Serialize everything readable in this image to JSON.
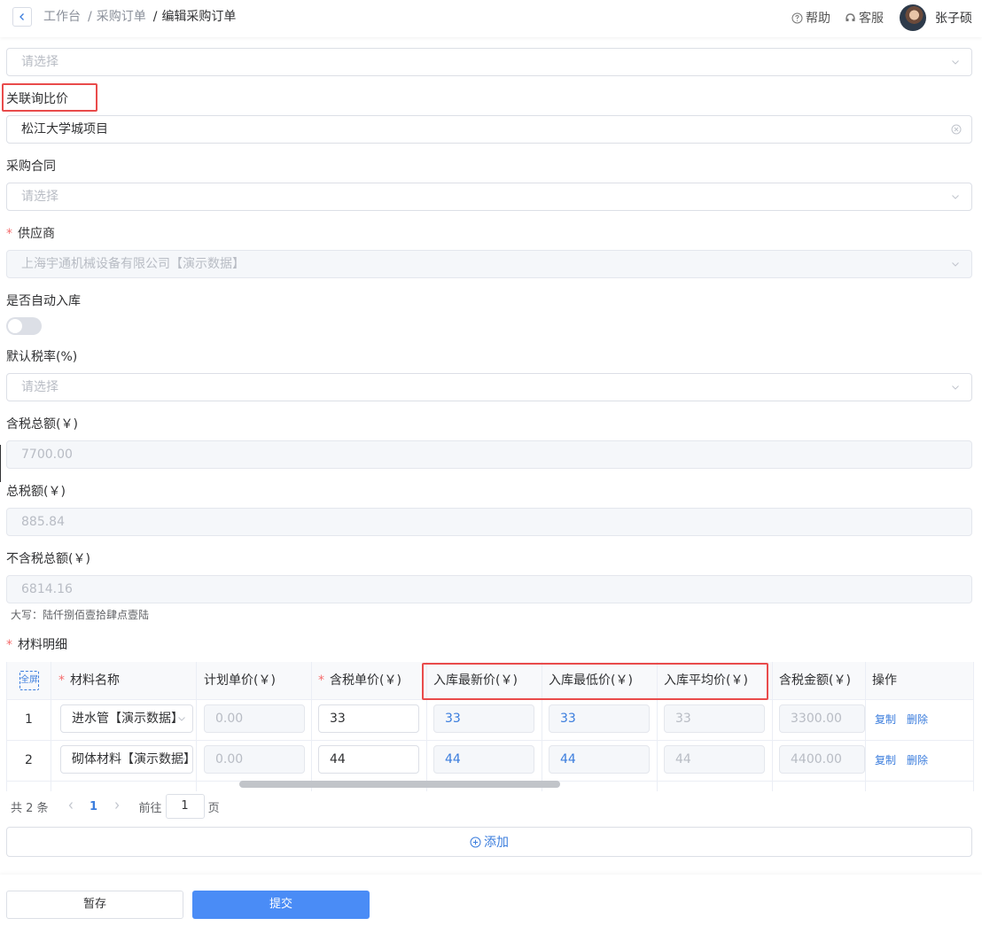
{
  "header": {
    "breadcrumb": [
      "工作台",
      "采购订单",
      "编辑采购订单"
    ],
    "help": "帮助",
    "service": "客服",
    "username": "张子硕"
  },
  "form": {
    "top_select": {
      "placeholder": "请选择"
    },
    "inquiry": {
      "label": "关联询比价",
      "value": "松江大学城项目"
    },
    "contract": {
      "label": "采购合同",
      "placeholder": "请选择"
    },
    "supplier": {
      "label": "供应商",
      "value": "上海宇通机械设备有限公司【演示数据】",
      "required": true
    },
    "auto_stock": {
      "label": "是否自动入库",
      "on": false
    },
    "tax_rate": {
      "label": "默认税率(%)",
      "placeholder": "请选择"
    },
    "total_incl": {
      "label": "含税总额(￥)",
      "value": "7700.00"
    },
    "total_tax": {
      "label": "总税额(￥)",
      "value": "885.84"
    },
    "total_excl": {
      "label": "不含税总额(￥)",
      "value": "6814.16"
    },
    "daxie": "大写：陆仟捌佰壹拾肆点壹陆",
    "materials_label": "材料明细"
  },
  "table": {
    "fullscreen": "全屏",
    "columns": [
      "材料名称",
      "计划单价(￥)",
      "含税单价(￥)",
      "入库最新价(￥)",
      "入库最低价(￥)",
      "入库平均价(￥)",
      "含税金额(￥)",
      "操作"
    ],
    "rows": [
      {
        "index": "1",
        "name": "进水管【演示数据】",
        "plan": "0.00",
        "price": "33",
        "latest": "33",
        "lowest": "33",
        "avg": "33",
        "amount": "3300.00",
        "copy": "复制",
        "delete": "删除"
      },
      {
        "index": "2",
        "name": "砌体材料【演示数据】",
        "plan": "0.00",
        "price": "44",
        "latest": "44",
        "lowest": "44",
        "avg": "44",
        "amount": "4400.00",
        "copy": "复制",
        "delete": "删除"
      }
    ]
  },
  "pager": {
    "total": "共 2 条",
    "current": "1",
    "goto": "前往",
    "page_input": "1",
    "page_unit": "页"
  },
  "add_label": "添加",
  "footer": {
    "save": "暂存",
    "submit": "提交"
  },
  "colors": {
    "accent": "#4a8cf6",
    "link": "#3b7ddd",
    "highlight": "#e94b4b",
    "required": "#f56c6c"
  }
}
